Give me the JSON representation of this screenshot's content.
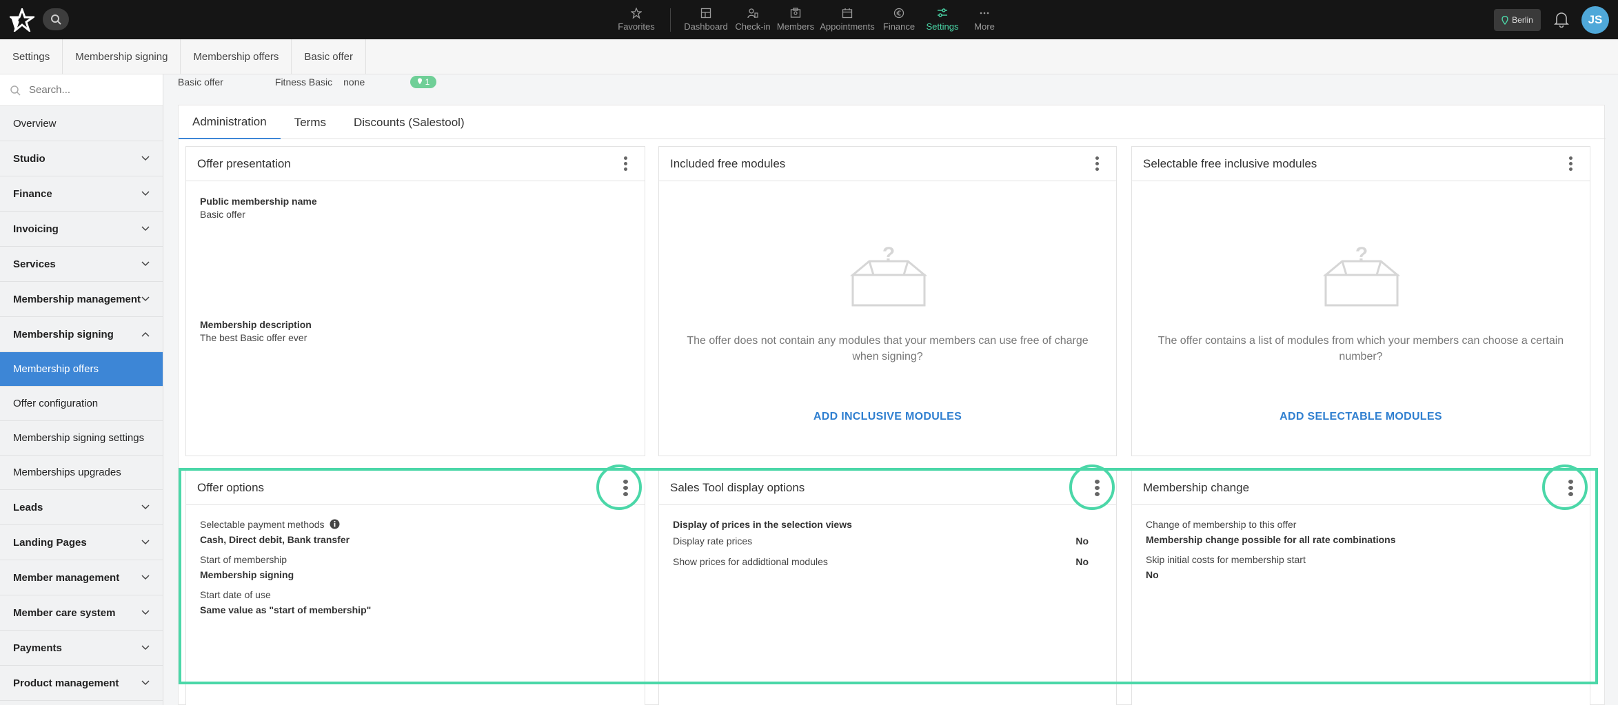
{
  "nav": {
    "items": [
      {
        "label": "Favorites",
        "icon": "star-icon"
      },
      {
        "label": "Dashboard",
        "icon": "dashboard-icon"
      },
      {
        "label": "Check-in",
        "icon": "check-in-icon"
      },
      {
        "label": "Members",
        "icon": "members-icon"
      },
      {
        "label": "Appointments",
        "icon": "calendar-icon"
      },
      {
        "label": "Finance",
        "icon": "euro-icon"
      },
      {
        "label": "Settings",
        "icon": "sliders-icon"
      },
      {
        "label": "More",
        "icon": "more-icon"
      }
    ],
    "location": "Berlin",
    "user_initials": "JS",
    "accent_color": "#4bd7a8"
  },
  "breadcrumb": [
    "Settings",
    "Membership signing",
    "Membership offers",
    "Basic offer"
  ],
  "sidebar": {
    "search_placeholder": "Search...",
    "items": [
      {
        "label": "Overview",
        "type": "link"
      },
      {
        "label": "Studio",
        "type": "group"
      },
      {
        "label": "Finance",
        "type": "group"
      },
      {
        "label": "Invoicing",
        "type": "group"
      },
      {
        "label": "Services",
        "type": "group"
      },
      {
        "label": "Membership management",
        "type": "group"
      },
      {
        "label": "Membership signing",
        "type": "group",
        "expanded": true
      },
      {
        "label": "Membership offers",
        "type": "sub",
        "active": true
      },
      {
        "label": "Offer configuration",
        "type": "sub"
      },
      {
        "label": "Membership signing settings",
        "type": "sub"
      },
      {
        "label": "Memberships upgrades",
        "type": "sub"
      },
      {
        "label": "Leads",
        "type": "group"
      },
      {
        "label": "Landing Pages",
        "type": "group"
      },
      {
        "label": "Member management",
        "type": "group"
      },
      {
        "label": "Member care system",
        "type": "group"
      },
      {
        "label": "Payments",
        "type": "group"
      },
      {
        "label": "Product management",
        "type": "group"
      }
    ]
  },
  "offer": {
    "name": "Basic offer",
    "rate": "Fitness Basic",
    "extra": "none",
    "location_count": "1"
  },
  "tabs": [
    "Administration",
    "Terms",
    "Discounts (Salestool)"
  ],
  "cards": {
    "offer_presentation": {
      "title": "Offer presentation",
      "public_name_label": "Public membership name",
      "public_name_value": "Basic offer",
      "description_label": "Membership description",
      "description_value": "The best Basic offer ever"
    },
    "included_free": {
      "title": "Included free modules",
      "empty_text": "The offer does not contain any modules that your members can use free of charge when signing?",
      "action": "ADD INCLUSIVE MODULES"
    },
    "selectable_free": {
      "title": "Selectable free inclusive modules",
      "empty_text": "The offer contains a list of modules from which your members can choose a certain number?",
      "action": "ADD SELECTABLE MODULES"
    },
    "offer_options": {
      "title": "Offer options",
      "payment_label": "Selectable payment methods",
      "payment_value": "Cash, Direct debit, Bank transfer",
      "start_label": "Start of membership",
      "start_value": "Membership signing",
      "use_label": "Start date of use",
      "use_value": "Same value as \"start of membership\""
    },
    "sales_tool": {
      "title": "Sales Tool display options",
      "section": "Display of prices in the selection views",
      "row1_label": "Display rate prices",
      "row1_value": "No",
      "row2_label": "Show prices for addidtional modules",
      "row2_value": "No"
    },
    "membership_change": {
      "title": "Membership change",
      "change_label": "Change of membership to this offer",
      "change_value": "Membership change possible for all rate combinations",
      "skip_label": "Skip initial costs for membership start",
      "skip_value": "No"
    }
  }
}
